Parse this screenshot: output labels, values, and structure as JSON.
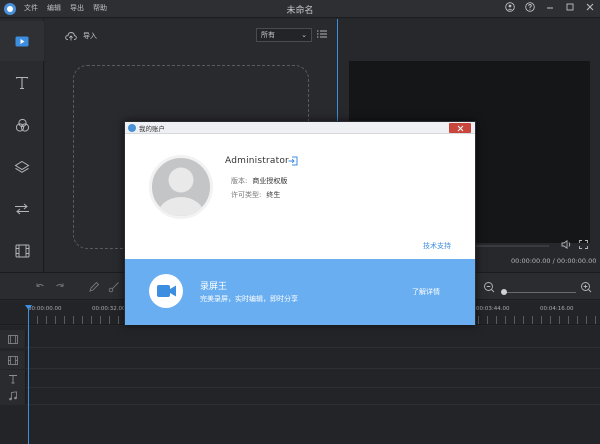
{
  "app": {
    "menu": [
      "文件",
      "编辑",
      "导出",
      "帮助"
    ],
    "title": "未命名"
  },
  "window_controls": [
    "user-icon",
    "help-icon",
    "minimize-icon",
    "maximize-icon",
    "close-icon"
  ],
  "sidebar": {
    "items": [
      {
        "name": "media",
        "icon": "media-icon",
        "active": true
      },
      {
        "name": "text",
        "icon": "text-icon"
      },
      {
        "name": "filter",
        "icon": "filter-icon"
      },
      {
        "name": "overlay",
        "icon": "overlay-icon"
      },
      {
        "name": "transition",
        "icon": "transition-icon"
      },
      {
        "name": "element",
        "icon": "element-icon"
      }
    ]
  },
  "media": {
    "import_label": "导入",
    "filter_value": "所有"
  },
  "preview": {
    "time": "00:00:00.00 / 00:00:00.00"
  },
  "timeline": {
    "ruler_labels": [
      "00:00:00.00",
      "00:00:32.00",
      "00:03:44.00",
      "00:04:16.00"
    ]
  },
  "dialog": {
    "title": "我的账户",
    "username": "Administrator",
    "version_label": "版本:",
    "version_value": "商业授权版",
    "license_label": "许可类型:",
    "license_value": "终生",
    "support_link": "技术支持",
    "promo": {
      "name": "录屏王",
      "description": "完美录屏，实时编辑，即时分享",
      "more_link": "了解详情"
    }
  },
  "colors": {
    "accent": "#3c8ee0",
    "promo_bg": "#68aef0",
    "close_red": "#c9463d"
  }
}
